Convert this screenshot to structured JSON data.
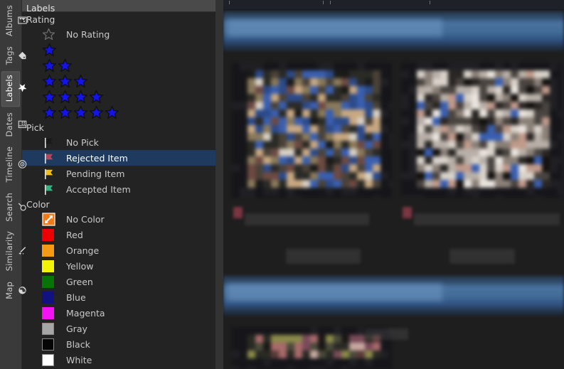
{
  "sidebar_tabs": [
    {
      "label": "Albums",
      "icon": "albums-icon",
      "selected": false
    },
    {
      "label": "Tags",
      "icon": "tag-icon",
      "selected": false
    },
    {
      "label": "Labels",
      "icon": "star-icon",
      "selected": true
    },
    {
      "label": "Dates",
      "icon": "calendar-icon",
      "selected": false
    },
    {
      "label": "Timeline",
      "icon": "timeline-icon",
      "selected": false
    },
    {
      "label": "Search",
      "icon": "search-icon",
      "selected": false
    },
    {
      "label": "Similarity",
      "icon": "wand-icon",
      "selected": false
    },
    {
      "label": "Map",
      "icon": "globe-icon",
      "selected": false
    }
  ],
  "panel": {
    "title": "Labels",
    "rating": {
      "group_label": "Rating",
      "no_rating_label": "No Rating",
      "star_color": "#1414e6",
      "star_rows": [
        1,
        2,
        3,
        4,
        5
      ]
    },
    "pick": {
      "group_label": "Pick",
      "items": [
        {
          "label": "No Pick",
          "flag_color": "#1a1a1a",
          "icon": "flag-icon",
          "selected": false
        },
        {
          "label": "Rejected Item",
          "flag_color": "#b3455e",
          "icon": "flag-icon",
          "selected": true
        },
        {
          "label": "Pending Item",
          "flag_color": "#f2c017",
          "icon": "flag-icon",
          "selected": false
        },
        {
          "label": "Accepted Item",
          "flag_color": "#35b37e",
          "icon": "flag-icon",
          "selected": false
        }
      ]
    },
    "color": {
      "group_label": "Color",
      "items": [
        {
          "label": "No Color",
          "swatch": "#f07a1a",
          "icon": "no-color-icon"
        },
        {
          "label": "Red",
          "swatch": "#ee0000",
          "icon": "color-swatch-icon"
        },
        {
          "label": "Orange",
          "swatch": "#f59a15",
          "icon": "color-swatch-icon"
        },
        {
          "label": "Yellow",
          "swatch": "#f2f20a",
          "icon": "color-swatch-icon"
        },
        {
          "label": "Green",
          "swatch": "#067406",
          "icon": "color-swatch-icon"
        },
        {
          "label": "Blue",
          "swatch": "#111180",
          "icon": "color-swatch-icon"
        },
        {
          "label": "Magenta",
          "swatch": "#f312f3",
          "icon": "color-swatch-icon"
        },
        {
          "label": "Gray",
          "swatch": "#a6a6a6",
          "icon": "color-swatch-icon"
        },
        {
          "label": "Black",
          "swatch": "#050505",
          "icon": "color-swatch-icon"
        },
        {
          "label": "White",
          "swatch": "#ffffff",
          "icon": "color-swatch-icon"
        }
      ]
    }
  },
  "content": {
    "selection_color": "#1f3a5f",
    "header_band_color": "#4a72a0",
    "background_color": "#1e1e1e"
  }
}
